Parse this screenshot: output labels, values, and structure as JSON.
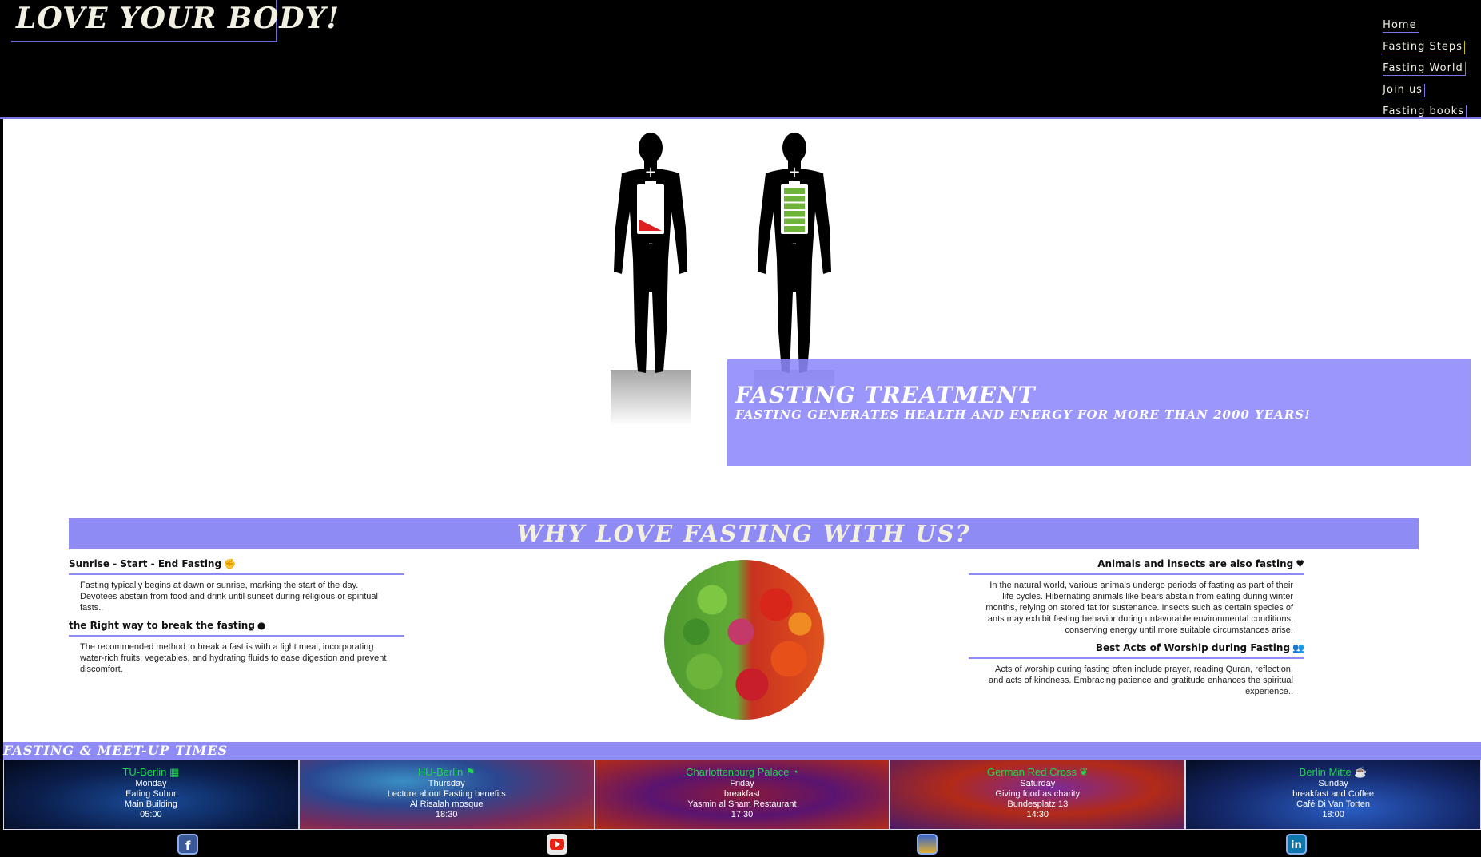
{
  "header": {
    "logo": "LOVE YOUR BODY!",
    "nav": [
      {
        "label": "Home"
      },
      {
        "label": "Fasting Steps"
      },
      {
        "label": "Fasting World"
      },
      {
        "label": "Join us"
      },
      {
        "label": "Fasting books"
      }
    ]
  },
  "hero": {
    "title": "FASTING TREATMENT",
    "subtitle": "FASTING GENERATES HEALTH AND ENERGY FOR MORE THAN 2000 YEARS!",
    "figures": {
      "left_battery_level": 0.2,
      "right_battery_level": 1.0,
      "colors": {
        "low": "#e02020",
        "full": "#6fb43a"
      }
    }
  },
  "why": {
    "title": "WHY LOVE FASTING WITH US?",
    "left": [
      {
        "heading": "Sunrise - Start - End Fasting",
        "icon": "fist-icon",
        "text": "Fasting typically begins at dawn or sunrise, marking the start of the day. Devotees abstain from food and drink until sunset during religious or spiritual fasts.."
      },
      {
        "heading": "the Right way to break the fasting",
        "icon": "brain-icon",
        "text": "The recommended method to break a fast is with a light meal, incorporating water-rich fruits, vegetables, and hydrating fluids to ease digestion and prevent discomfort."
      }
    ],
    "right": [
      {
        "heading": "Animals and insects are also fasting",
        "icon": "heart-icon",
        "text": "In the natural world, various animals undergo periods of fasting as part of their life cycles. Hibernating animals like bears abstain from eating during winter months, relying on stored fat for sustenance. Insects such as certain species of ants may exhibit fasting behavior during unfavorable environmental conditions, conserving energy until more suitable circumstances arise."
      },
      {
        "heading": "Best Acts of Worship during Fasting",
        "icon": "users-icon",
        "text": "Acts of worship during fasting often include prayer, reading Quran, reflection, and acts of kindness. Embracing patience and gratitude enhances the spiritual experience.."
      }
    ]
  },
  "meetups": {
    "title": "FASTING & MEET-UP TIMES",
    "cards": [
      {
        "place": "TU-Berlin",
        "icon": "building-icon",
        "day": "Monday",
        "activity": "Eating Suhur",
        "location": "Main Building",
        "time": "05:00"
      },
      {
        "place": "HU-Berlin",
        "icon": "flag-icon",
        "day": "Thursday",
        "activity": "Lecture about Fasting benefits",
        "location": "Al Risalah mosque",
        "time": "18:30"
      },
      {
        "place": "Charlottenburg Palace",
        "icon": "food-icon",
        "day": "Friday",
        "activity": "breakfast",
        "location": "Yasmin al Sham Restaurant",
        "time": "17:30"
      },
      {
        "place": "German Red Cross",
        "icon": "leaf-icon",
        "day": "Saturday",
        "activity": "Giving food as charity",
        "location": "Bundesplatz 13",
        "time": "14:30"
      },
      {
        "place": "Berlin Mitte",
        "icon": "coffee-icon",
        "day": "Sunday",
        "activity": "breakfast and Coffee",
        "location": "Café Di Van Torten",
        "time": "18:00"
      }
    ]
  },
  "social": [
    {
      "name": "facebook-icon",
      "glyph": "f"
    },
    {
      "name": "youtube-icon",
      "glyph": ""
    },
    {
      "name": "berlin-icon",
      "glyph": ""
    },
    {
      "name": "linkedin-icon",
      "glyph": "in"
    }
  ]
}
